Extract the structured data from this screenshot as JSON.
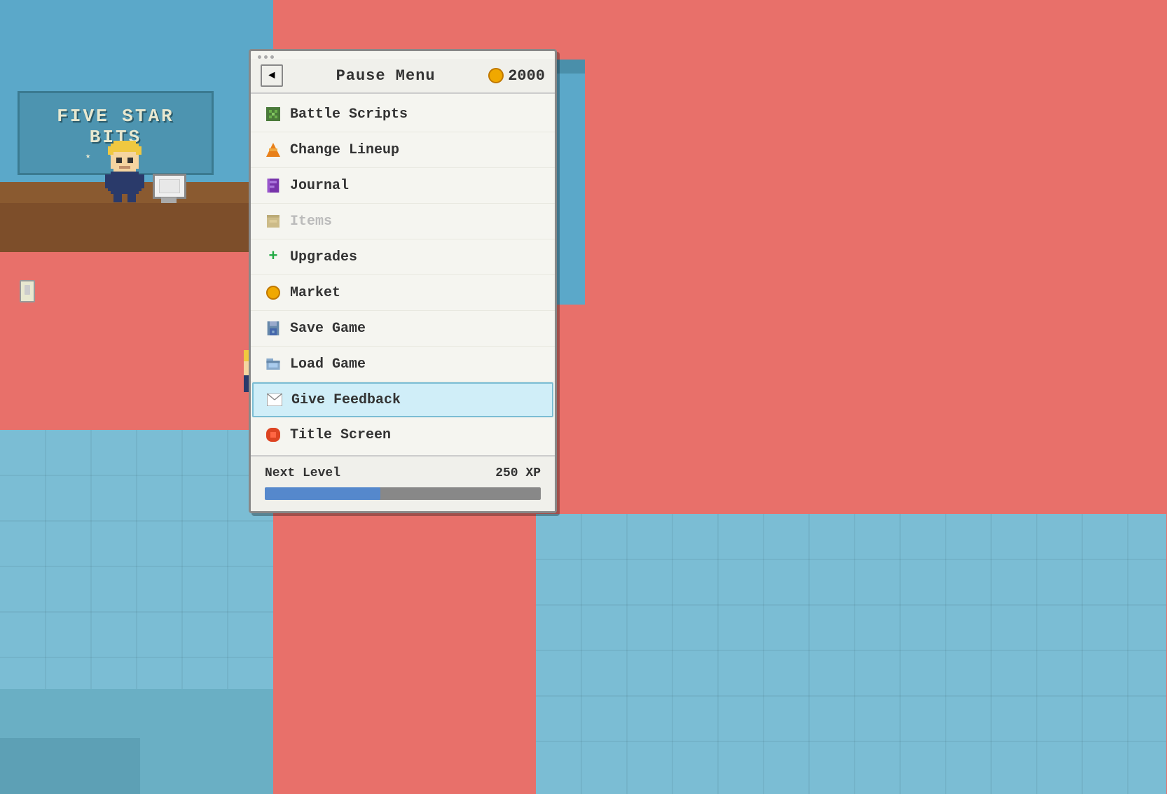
{
  "background": {
    "color": "#e8706a",
    "wall_color": "#5ba8c9",
    "floor_color": "#7bbdd4"
  },
  "shop": {
    "name_line1": "FIVE STAR",
    "name_line2": "BITS",
    "stars": "★ ★ ★"
  },
  "menu": {
    "title": "Pause Menu",
    "back_label": "◄",
    "coin_amount": "2000",
    "items": [
      {
        "id": "battle-scripts",
        "label": "Battle Scripts",
        "icon": "🟩",
        "disabled": false,
        "selected": false
      },
      {
        "id": "change-lineup",
        "label": "Change Lineup",
        "icon": "🔶",
        "disabled": false,
        "selected": false
      },
      {
        "id": "journal",
        "label": "Journal",
        "icon": "📒",
        "disabled": false,
        "selected": false
      },
      {
        "id": "items",
        "label": "Items",
        "icon": "📦",
        "disabled": true,
        "selected": false
      },
      {
        "id": "upgrades",
        "label": "Upgrades",
        "icon": "+",
        "disabled": false,
        "selected": false
      },
      {
        "id": "market",
        "label": "Market",
        "icon": "🪙",
        "disabled": false,
        "selected": false
      },
      {
        "id": "save-game",
        "label": "Save Game",
        "icon": "💾",
        "disabled": false,
        "selected": false
      },
      {
        "id": "load-game",
        "label": "Load Game",
        "icon": "📂",
        "disabled": false,
        "selected": false
      },
      {
        "id": "give-feedback",
        "label": "Give Feedback",
        "icon": "✉",
        "disabled": false,
        "selected": true
      },
      {
        "id": "title-screen",
        "label": "Title Screen",
        "icon": "🔴",
        "disabled": false,
        "selected": false
      }
    ],
    "xp": {
      "label": "Next Level",
      "value": "250 XP",
      "fill_percent": 42
    }
  }
}
